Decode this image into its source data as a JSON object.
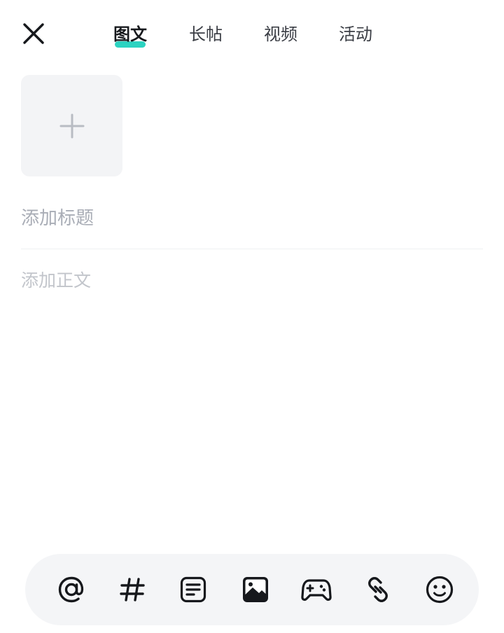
{
  "header": {
    "tabs": [
      {
        "label": "图文",
        "active": true
      },
      {
        "label": "长帖",
        "active": false
      },
      {
        "label": "视频",
        "active": false
      },
      {
        "label": "活动",
        "active": false
      }
    ],
    "accent_color": "#2cd3c1"
  },
  "editor": {
    "title_placeholder": "添加标题",
    "body_placeholder": "添加正文"
  },
  "toolbar": {
    "items": [
      {
        "icon": "at-icon"
      },
      {
        "icon": "hashtag-icon"
      },
      {
        "icon": "document-icon"
      },
      {
        "icon": "image-icon"
      },
      {
        "icon": "gamepad-icon"
      },
      {
        "icon": "link-icon"
      },
      {
        "icon": "emoji-icon"
      }
    ]
  }
}
